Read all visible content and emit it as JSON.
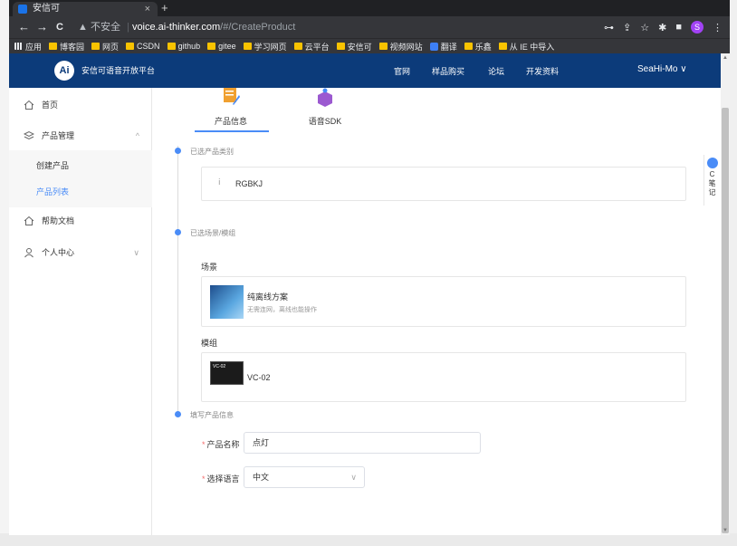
{
  "browser": {
    "tab_title": "安信可",
    "tab_close": "×",
    "new_tab": "+",
    "nav_back": "←",
    "nav_forward": "→",
    "nav_reload": "C",
    "security": "▲ 不安全",
    "url_host": "voice.ai-thinker.com",
    "url_path": "/#/CreateProduct",
    "profile_initial": "S",
    "bookmarks": [
      {
        "label": "应用",
        "kind": "apps"
      },
      {
        "label": "博客园",
        "kind": "folder"
      },
      {
        "label": "网页",
        "kind": "folder"
      },
      {
        "label": "CSDN",
        "kind": "folder"
      },
      {
        "label": "github",
        "kind": "folder"
      },
      {
        "label": "gitee",
        "kind": "folder"
      },
      {
        "label": "学习网页",
        "kind": "folder"
      },
      {
        "label": "云平台",
        "kind": "folder"
      },
      {
        "label": "安信可",
        "kind": "folder"
      },
      {
        "label": "视频网站",
        "kind": "folder"
      },
      {
        "label": "翻译",
        "kind": "translate"
      },
      {
        "label": "乐鑫",
        "kind": "folder"
      },
      {
        "label": "从 IE 中导入",
        "kind": "folder"
      }
    ]
  },
  "header": {
    "logo_text": "Ai",
    "brand": "安信可语音开放平台",
    "nav": [
      "官网",
      "样品购买",
      "论坛",
      "开发资料"
    ],
    "user": "SeaHi-Mo ∨"
  },
  "sidebar": {
    "items": [
      {
        "label": "首页",
        "icon": "home-icon"
      },
      {
        "label": "产品管理",
        "icon": "layers-icon",
        "chevron": "^"
      },
      {
        "label": "创建产品"
      },
      {
        "label": "产品列表"
      },
      {
        "label": "帮助文档",
        "icon": "home-icon"
      },
      {
        "label": "个人中心",
        "icon": "user-icon",
        "chevron": "∨"
      }
    ]
  },
  "content": {
    "tabs": [
      "产品信息",
      "语音SDK"
    ],
    "steps": {
      "category": "已选产品类别",
      "scene_module": "已选场景/模组",
      "product_info": "填写产品信息"
    },
    "category_value": "RGBKJ",
    "scene_label": "场景",
    "scene_title": "纯离线方案",
    "scene_desc": "无需连网，离线也能操作",
    "module_label": "模组",
    "module_name": "VC-02",
    "module_thumb_text": "VC-02",
    "form": {
      "name_label": "产品名称",
      "name_value": "点灯",
      "lang_label": "选择语言",
      "lang_value": "中文",
      "required_mark": "*"
    },
    "note_button": "C笔记"
  },
  "colors": {
    "header_bg": "#0c3b7a",
    "accent": "#4a8cf7"
  }
}
